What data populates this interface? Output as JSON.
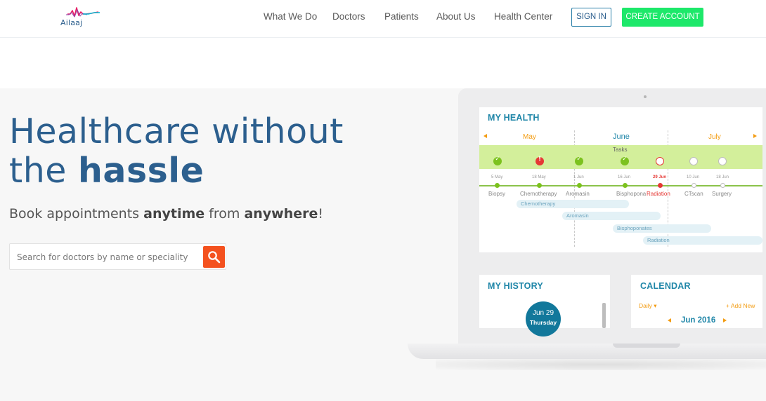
{
  "brand": {
    "name": "Ailaaj"
  },
  "nav": {
    "items": [
      "What We Do",
      "Doctors",
      "Patients",
      "About Us",
      "Health Center"
    ],
    "sign_in": "SIGN IN",
    "create_account": "CREATE ACCOUNT"
  },
  "hero": {
    "title_line1": "Healthcare without",
    "title_line2_normal": "the ",
    "title_line2_bold": "hassle",
    "sub_1": "Book appointments ",
    "sub_bold_1": "anytime",
    "sub_2": " from ",
    "sub_bold_2": "anywhere",
    "sub_3": "!",
    "search_placeholder": "Search for doctors by name or speciality"
  },
  "dashboard": {
    "my_health": {
      "title": "MY HEALTH",
      "months": [
        "May",
        "June",
        "July"
      ],
      "tasks_label": "Tasks",
      "tasks": [
        {
          "status": "done"
        },
        {
          "status": "error"
        },
        {
          "status": "done"
        },
        {
          "status": "done"
        },
        {
          "status": "pending"
        },
        {
          "status": "todo"
        },
        {
          "status": "todo"
        }
      ],
      "timeline": [
        {
          "date": "5 May",
          "label": "Biopsy"
        },
        {
          "date": "18 May",
          "label": "Chemotherapy"
        },
        {
          "date": "1 Jun",
          "label": "Aromasin"
        },
        {
          "date": "16 Jun",
          "label": "Bisphoponates"
        },
        {
          "date": "29 Jun",
          "label": "Radiation"
        },
        {
          "date": "10 Jun",
          "label": "CTscan"
        },
        {
          "date": "18 Jun",
          "label": "Surgery"
        }
      ],
      "gantt": [
        "Chemotherapy",
        "Aromasin",
        "Bisphoponates",
        "Radiation"
      ]
    },
    "my_history": {
      "title": "MY HISTORY",
      "day": "Jun 29",
      "weekday": "Thursday"
    },
    "calendar": {
      "title": "CALENDAR",
      "view": "Daily",
      "add": "+ Add New",
      "month": "Jun 2016"
    }
  },
  "colors": {
    "brand_blue": "#2c5f8e",
    "accent_green": "#1de86a",
    "search_orange": "#f4511e",
    "teal": "#1f86a8",
    "task_green": "#7cc21e",
    "task_red": "#e53935",
    "month_orange": "#f39c12"
  }
}
